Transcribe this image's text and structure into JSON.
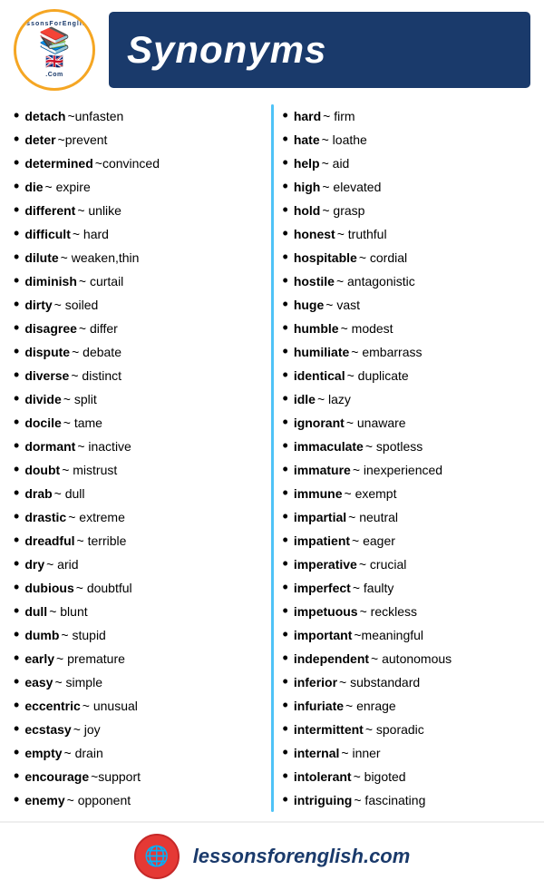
{
  "header": {
    "logo_arc_top": "LessonsForEnglish",
    "logo_arc_bottom": ".Com",
    "title": "Synonyms"
  },
  "left_column": [
    {
      "word": "detach",
      "synonym": "~unfasten"
    },
    {
      "word": "deter",
      "synonym": "~prevent"
    },
    {
      "word": "determined",
      "synonym": "~convinced"
    },
    {
      "word": "die",
      "synonym": "~ expire"
    },
    {
      "word": "different",
      "synonym": "~ unlike"
    },
    {
      "word": "difficult",
      "synonym": "~ hard"
    },
    {
      "word": "dilute",
      "synonym": "~ weaken,thin"
    },
    {
      "word": "diminish",
      "synonym": "~ curtail"
    },
    {
      "word": "dirty",
      "synonym": "~ soiled"
    },
    {
      "word": "disagree",
      "synonym": "~ differ"
    },
    {
      "word": "dispute",
      "synonym": "~ debate"
    },
    {
      "word": "diverse",
      "synonym": "~ distinct"
    },
    {
      "word": "divide",
      "synonym": "~ split"
    },
    {
      "word": "docile",
      "synonym": "~ tame"
    },
    {
      "word": "dormant",
      "synonym": "~ inactive"
    },
    {
      "word": "doubt",
      "synonym": "~ mistrust"
    },
    {
      "word": "drab",
      "synonym": "~ dull"
    },
    {
      "word": "drastic",
      "synonym": "~ extreme"
    },
    {
      "word": "dreadful",
      "synonym": "~ terrible"
    },
    {
      "word": "dry",
      "synonym": "~ arid"
    },
    {
      "word": "dubious",
      "synonym": "~ doubtful"
    },
    {
      "word": "dull",
      "synonym": "~ blunt"
    },
    {
      "word": "dumb",
      "synonym": "~ stupid"
    },
    {
      "word": "early",
      "synonym": "~ premature"
    },
    {
      "word": "easy",
      "synonym": "~ simple"
    },
    {
      "word": "eccentric",
      "synonym": "~ unusual"
    },
    {
      "word": "ecstasy",
      "synonym": "~ joy"
    },
    {
      "word": "empty",
      "synonym": "~ drain"
    },
    {
      "word": "encourage",
      "synonym": "~support"
    },
    {
      "word": "enemy",
      "synonym": "~ opponent"
    }
  ],
  "right_column": [
    {
      "word": "hard",
      "synonym": "~ firm"
    },
    {
      "word": "hate",
      "synonym": "~ loathe"
    },
    {
      "word": "help",
      "synonym": "~ aid"
    },
    {
      "word": "high",
      "synonym": "~ elevated"
    },
    {
      "word": "hold",
      "synonym": "~ grasp"
    },
    {
      "word": "honest",
      "synonym": "~ truthful"
    },
    {
      "word": "hospitable",
      "synonym": "~ cordial"
    },
    {
      "word": "hostile",
      "synonym": "~ antagonistic"
    },
    {
      "word": "huge",
      "synonym": "~ vast"
    },
    {
      "word": "humble",
      "synonym": "~ modest"
    },
    {
      "word": "humiliate",
      "synonym": "~ embarrass"
    },
    {
      "word": "identical",
      "synonym": "~ duplicate"
    },
    {
      "word": "idle",
      "synonym": "~ lazy"
    },
    {
      "word": "ignorant",
      "synonym": "~ unaware"
    },
    {
      "word": "immaculate",
      "synonym": "~ spotless"
    },
    {
      "word": "immature",
      "synonym": "~ inexperienced"
    },
    {
      "word": "immune",
      "synonym": "~ exempt"
    },
    {
      "word": "impartial",
      "synonym": "~ neutral"
    },
    {
      "word": "impatient",
      "synonym": "~ eager"
    },
    {
      "word": "imperative",
      "synonym": "~ crucial"
    },
    {
      "word": "imperfect",
      "synonym": "~ faulty"
    },
    {
      "word": "impetuous",
      "synonym": "~ reckless"
    },
    {
      "word": "important",
      "synonym": "~meaningful"
    },
    {
      "word": "independent",
      "synonym": "~ autonomous"
    },
    {
      "word": "inferior",
      "synonym": "~ substandard"
    },
    {
      "word": "infuriate",
      "synonym": "~ enrage"
    },
    {
      "word": "intermittent",
      "synonym": "~ sporadic"
    },
    {
      "word": "internal",
      "synonym": "~ inner"
    },
    {
      "word": "intolerant",
      "synonym": "~ bigoted"
    },
    {
      "word": "intriguing",
      "synonym": "~ fascinating"
    }
  ],
  "footer": {
    "url": "lessonsforenglish.com",
    "globe_icon": "🌐"
  }
}
